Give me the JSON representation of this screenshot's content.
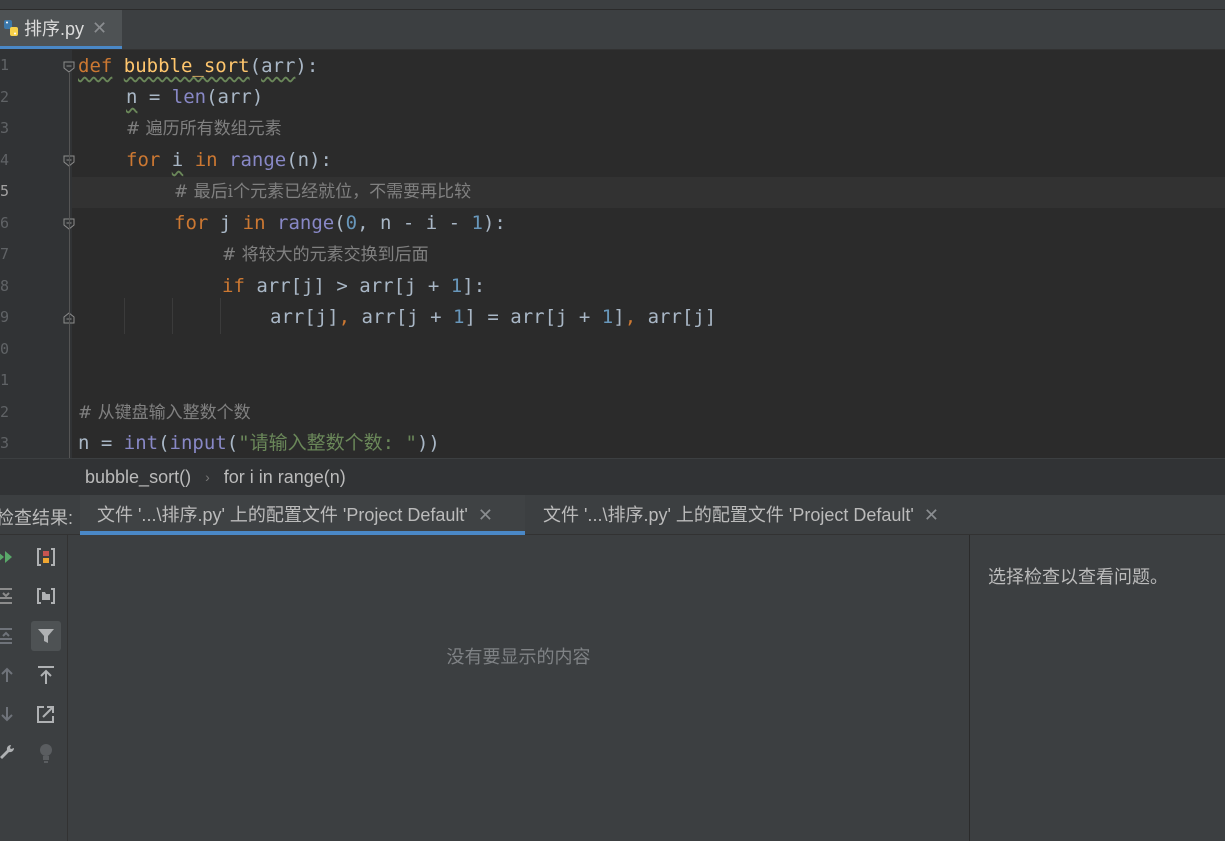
{
  "editor_tab": {
    "filename": "排序.py",
    "close": "✕"
  },
  "gutter": {
    "line_numbers": [
      "1",
      "2",
      "3",
      "4",
      "5",
      "6",
      "7",
      "8",
      "9",
      "0",
      "1",
      "2",
      "3"
    ],
    "current_line": "5"
  },
  "code": {
    "l1_def": "def",
    "l1_name": "bubble_sort",
    "l1_rest_a": "(",
    "l1_param": "arr",
    "l1_rest_b": "):",
    "l2_n": "n",
    "l2_eq": " = ",
    "l2_len": "len",
    "l2_rest": "(arr)",
    "l3_comment": "# 遍历所有数组元素",
    "l4_for": "for",
    "l4_i": "i",
    "l4_in": "in",
    "l4_range": "range",
    "l4_rest": "(n):",
    "l5_comment": "# 最后i个元素已经就位，不需要再比较",
    "l6_for": "for",
    "l6_j": " j ",
    "l6_in": "in",
    "l6_range": "range",
    "l6_a": "(",
    "l6_zero": "0",
    "l6_b": ", n - i - ",
    "l6_one": "1",
    "l6_c": "):",
    "l7_comment": "# 将较大的元素交换到后面",
    "l8_if": "if",
    "l8_a": " arr[j] > arr[j + ",
    "l8_one": "1",
    "l8_b": "]:",
    "l9_a": "arr[j]",
    "l9_comma1": ",",
    "l9_b": " arr[j + ",
    "l9_one1": "1",
    "l9_c": "] = arr[j + ",
    "l9_one2": "1",
    "l9_d": "]",
    "l9_comma2": ",",
    "l9_e": " arr[j]",
    "l12_comment": "# 从键盘输入整数个数",
    "l13_n": "n = ",
    "l13_int": "int",
    "l13_a": "(",
    "l13_input": "input",
    "l13_b": "(",
    "l13_str": "\"请输入整数个数: \"",
    "l13_c": "))"
  },
  "breadcrumb": {
    "item1": "bubble_sort()",
    "sep": "›",
    "item2": "for i in range(n)"
  },
  "problems": {
    "label": "检查结果:",
    "tabs": [
      {
        "label": "文件 '...\\排序.py' 上的配置文件 'Project Default'",
        "close": "✕"
      },
      {
        "label": "文件 '...\\排序.py' 上的配置文件 'Project Default'",
        "close": "✕"
      }
    ],
    "empty_message": "没有要显示的内容",
    "right_message": "选择检查以查看问题。"
  },
  "tools": [
    "rerun-icon",
    "expand-all-icon",
    "collapse-all-icon",
    "previous-icon",
    "next-icon",
    "settings-wrench-icon",
    "export-icon",
    "group-icon",
    "filter-icon",
    "autoscroll-icon",
    "open-external-icon",
    "lightbulb-icon"
  ],
  "colors": {
    "accent": "#4a88c7",
    "keyword": "#cc7832",
    "function": "#ffc66d",
    "builtin": "#8888c6",
    "number": "#6897bb",
    "comment": "#808080",
    "string": "#6a8759"
  }
}
